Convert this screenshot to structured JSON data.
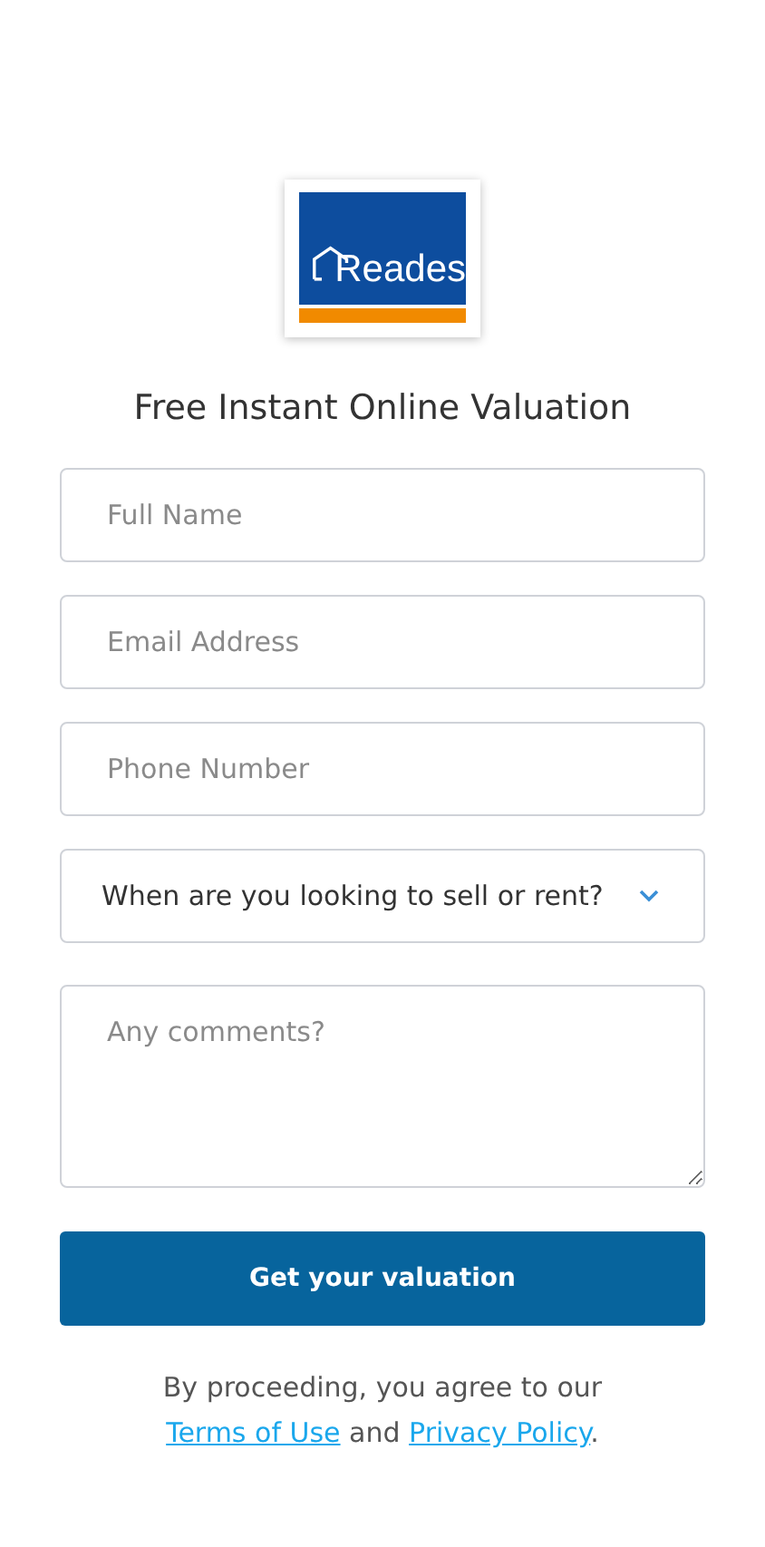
{
  "logo": {
    "text": "Reades"
  },
  "title": "Free Instant Online Valuation",
  "fields": [
    {
      "kind": "input",
      "placeholder": "Full Name"
    },
    {
      "kind": "input",
      "placeholder": "Email Address"
    },
    {
      "kind": "input",
      "placeholder": "Phone Number"
    },
    {
      "kind": "select",
      "value": "When are you looking to sell or rent?"
    },
    {
      "kind": "textarea",
      "placeholder": "Any comments?"
    }
  ],
  "submit": "Get your valuation",
  "consent": [
    {
      "kind": "text",
      "text": "By proceeding, you agree to our "
    },
    {
      "kind": "link",
      "text": "Terms of Use"
    },
    {
      "kind": "text",
      "text": " and "
    },
    {
      "kind": "link",
      "text": "Privacy Policy"
    },
    {
      "kind": "text",
      "text": "."
    }
  ]
}
